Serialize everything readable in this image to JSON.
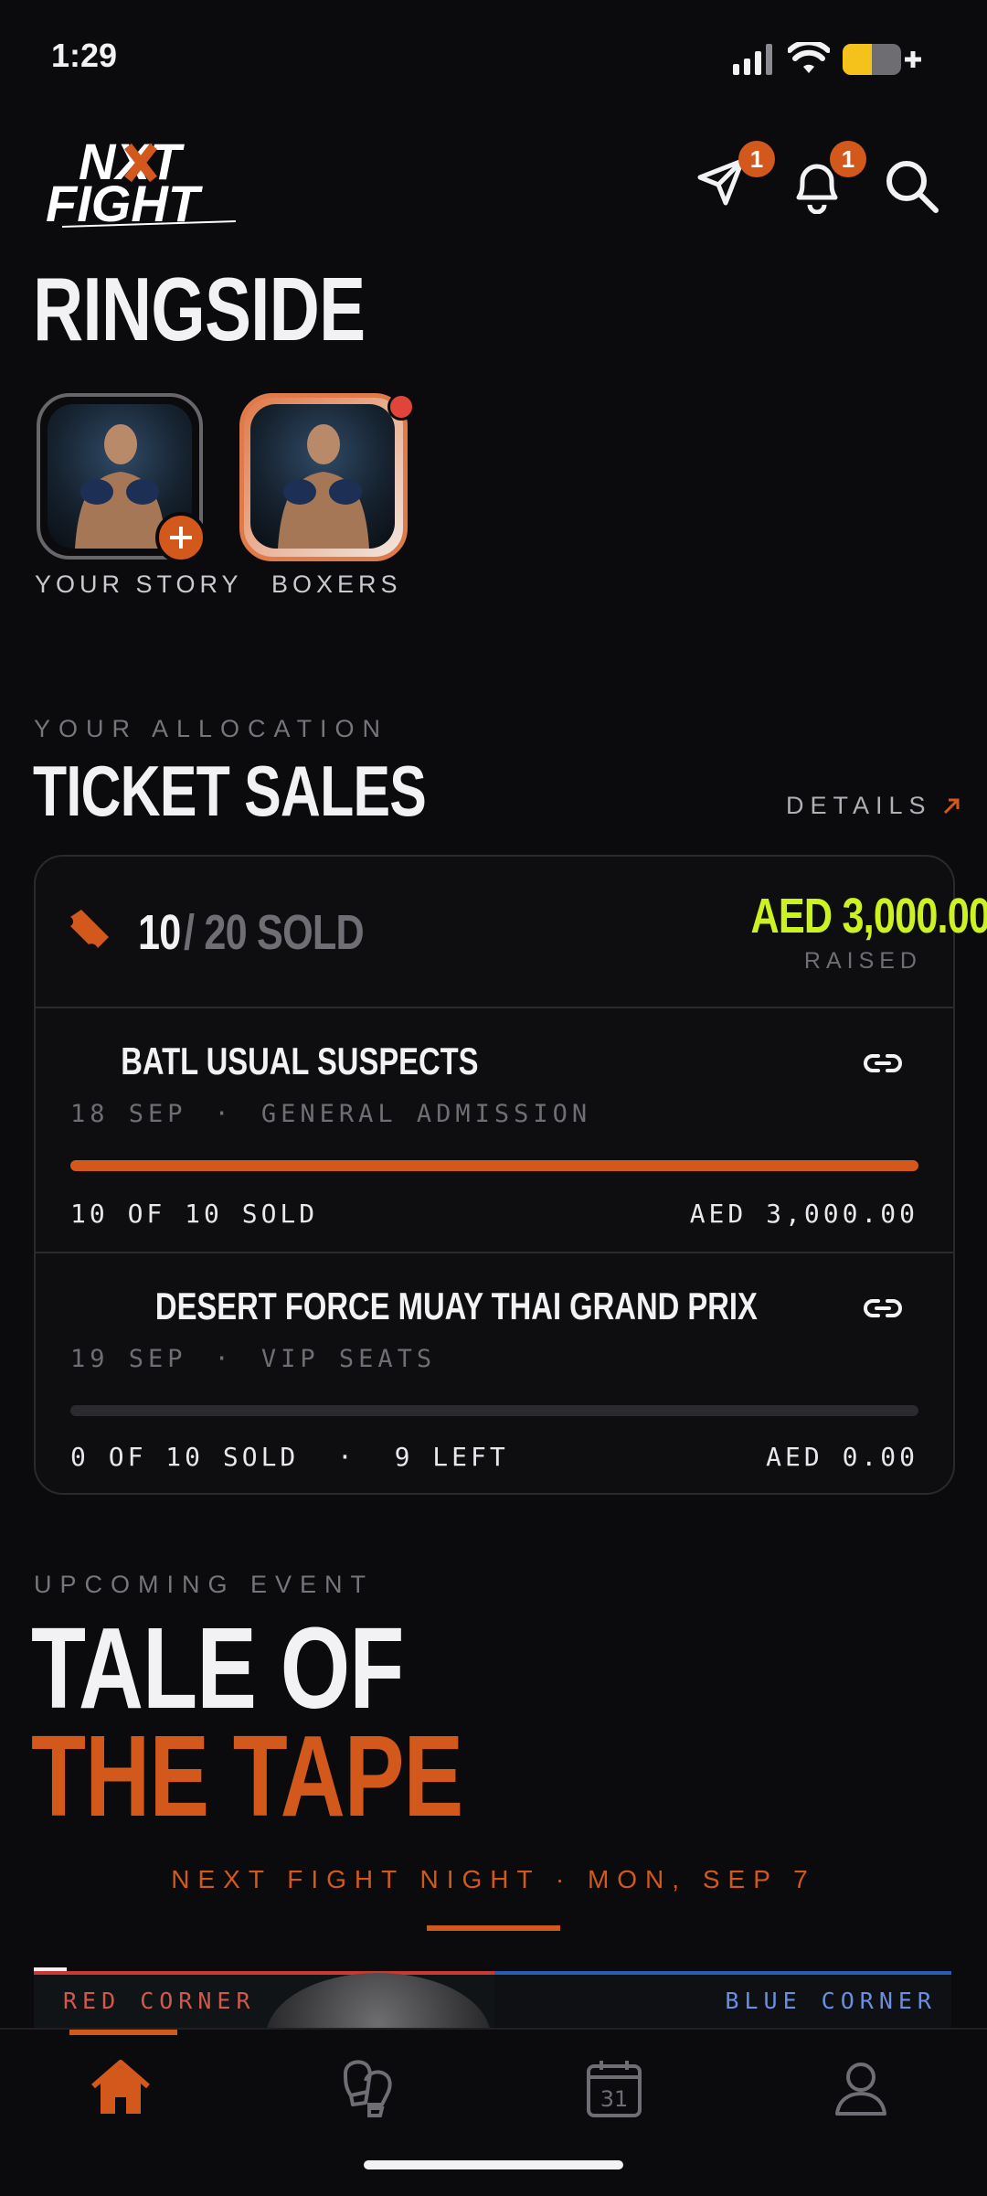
{
  "status_bar": {
    "time": "1:29"
  },
  "header": {
    "logo_line1": "NXT",
    "logo_line2": "FIGHT",
    "messages_badge": "1",
    "notifications_badge": "1"
  },
  "ringside": {
    "title": "RINGSIDE",
    "stories": [
      {
        "label": "YOUR STORY"
      },
      {
        "label": "BOXERS"
      }
    ]
  },
  "tickets": {
    "eyebrow": "YOUR ALLOCATION",
    "title": "TICKET SALES",
    "details_link": "DETAILS",
    "sold": "10",
    "total": "/ 20 SOLD",
    "raised_amount": "AED 3,000.00",
    "raised_label": "RAISED",
    "events": [
      {
        "name": "BATL USUAL SUSPECTS",
        "date": "18 SEP",
        "separator": "·",
        "type": "GENERAL ADMISSION",
        "progress": 1.0,
        "sold_text": "10 OF 10 SOLD",
        "amount": "AED 3,000.00"
      },
      {
        "name": "DESERT FORCE MUAY THAI GRAND PRIX",
        "date": "19 SEP",
        "separator": "·",
        "type": "VIP SEATS",
        "progress": 0.0,
        "sold_text": "0 OF 10 SOLD  ·  9 LEFT",
        "amount": "AED 0.00"
      }
    ]
  },
  "upcoming": {
    "eyebrow": "UPCOMING EVENT",
    "title_line1": "TALE OF",
    "title_line2": "THE TAPE",
    "next_fight": "NEXT FIGHT NIGHT · MON, SEP 7",
    "red_corner": "RED CORNER",
    "blue_corner": "BLUE CORNER"
  },
  "nav": {
    "calendar_day": "31"
  },
  "colors": {
    "accent": "#d2581c",
    "lime": "#cdf221",
    "background": "#0b0b0d"
  }
}
